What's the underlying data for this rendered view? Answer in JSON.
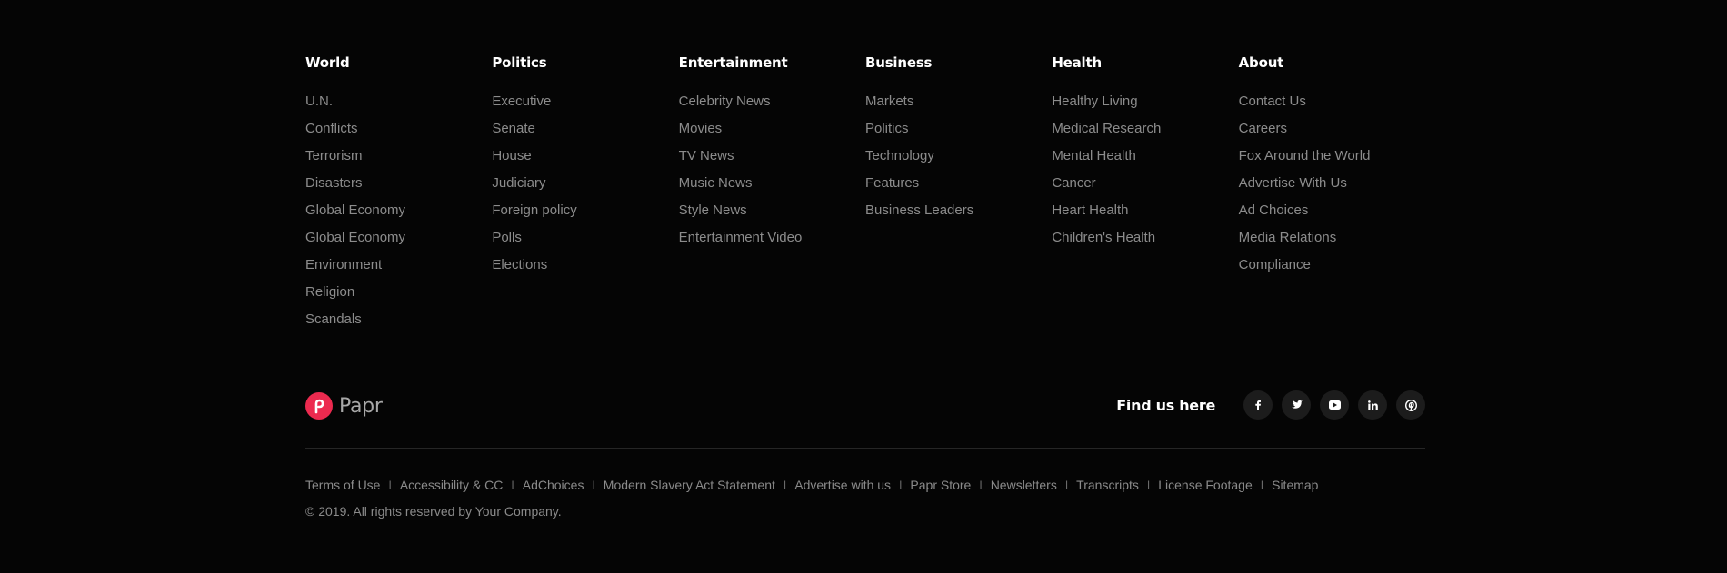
{
  "columns": [
    {
      "title": "World",
      "items": [
        "U.N.",
        "Conflicts",
        "Terrorism",
        "Disasters",
        "Global Economy",
        "Global Economy",
        "Environment",
        "Religion",
        "Scandals"
      ]
    },
    {
      "title": "Politics",
      "items": [
        "Executive",
        "Senate",
        "House",
        "Judiciary",
        "Foreign policy",
        "Polls",
        "Elections"
      ]
    },
    {
      "title": "Entertainment",
      "items": [
        "Celebrity News",
        "Movies",
        "TV News",
        "Music News",
        "Style News",
        "Entertainment Video"
      ]
    },
    {
      "title": "Business",
      "items": [
        "Markets",
        "Politics",
        "Technology",
        "Features",
        "Business Leaders"
      ]
    },
    {
      "title": "Health",
      "items": [
        "Healthy Living",
        "Medical Research",
        "Mental Health",
        "Cancer",
        "Heart Health",
        "Children's Health"
      ]
    },
    {
      "title": "About",
      "items": [
        "Contact Us",
        "Careers",
        "Fox Around the World",
        "Advertise With Us",
        "Ad Choices",
        "Media Relations",
        "Compliance"
      ]
    }
  ],
  "brand": {
    "name": "Papr",
    "accent_color": "#ec2a4f"
  },
  "social": {
    "label": "Find us here",
    "icons": [
      "facebook-icon",
      "twitter-icon",
      "youtube-icon",
      "linkedin-icon",
      "pinterest-icon"
    ]
  },
  "legal": {
    "links": [
      "Terms of Use",
      "Accessibility & CC",
      "AdChoices",
      "Modern Slavery Act Statement",
      "Advertise with us",
      "Papr Store",
      "Newsletters",
      "Transcripts",
      "License Footage",
      "Sitemap"
    ],
    "separator": "I",
    "copyright": "© 2019. All rights reserved by Your Company."
  },
  "colors": {
    "background": "#050505",
    "heading": "#ffffff",
    "link": "#8c8c8c",
    "icon_bg": "#1c1c1c"
  }
}
